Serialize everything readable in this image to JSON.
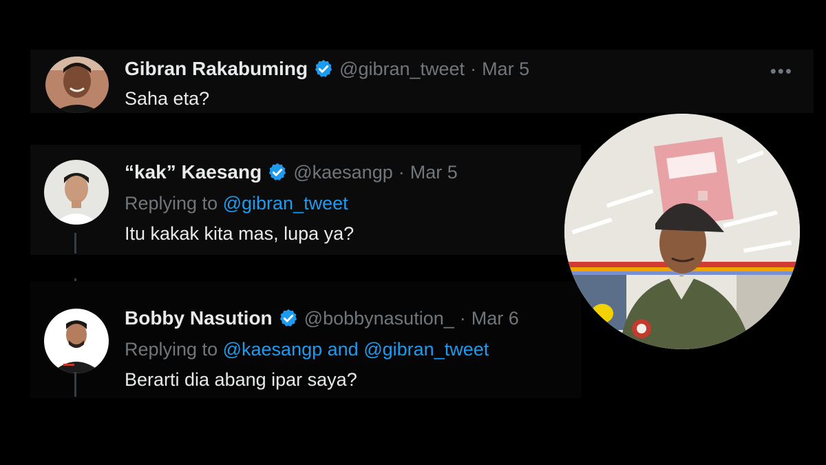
{
  "colors": {
    "background": "#000000",
    "name_text": "#e7e9ea",
    "muted_text": "#71767b",
    "accent_blue": "#1d9bf0",
    "verified_badge": "#1d9bf0"
  },
  "tweets": [
    {
      "name": "Gibran Rakabuming",
      "verified_icon": "verified-badge-icon",
      "handle": "@gibran_tweet",
      "separator": "·",
      "date": "Mar 5",
      "text": "Saha eta?",
      "more_icon": "•••"
    },
    {
      "name": "“kak” Kaesang",
      "verified_icon": "verified-badge-icon",
      "handle": "@kaesangp",
      "separator": "·",
      "date": "Mar 5",
      "replying_prefix": "Replying to",
      "replying_mention_1": "@gibran_tweet",
      "text": "Itu kakak kita mas, lupa ya?"
    },
    {
      "name": "Bobby Nasution",
      "verified_icon": "verified-badge-icon",
      "handle": "@bobbynasution_",
      "separator": "·",
      "date": "Mar 6",
      "replying_prefix": "Replying to",
      "replying_mention_1": "@kaesangp",
      "replying_and": "and",
      "replying_mention_2": "@gibran_tweet",
      "text": "Berarti dia abang ipar saya?"
    }
  ]
}
